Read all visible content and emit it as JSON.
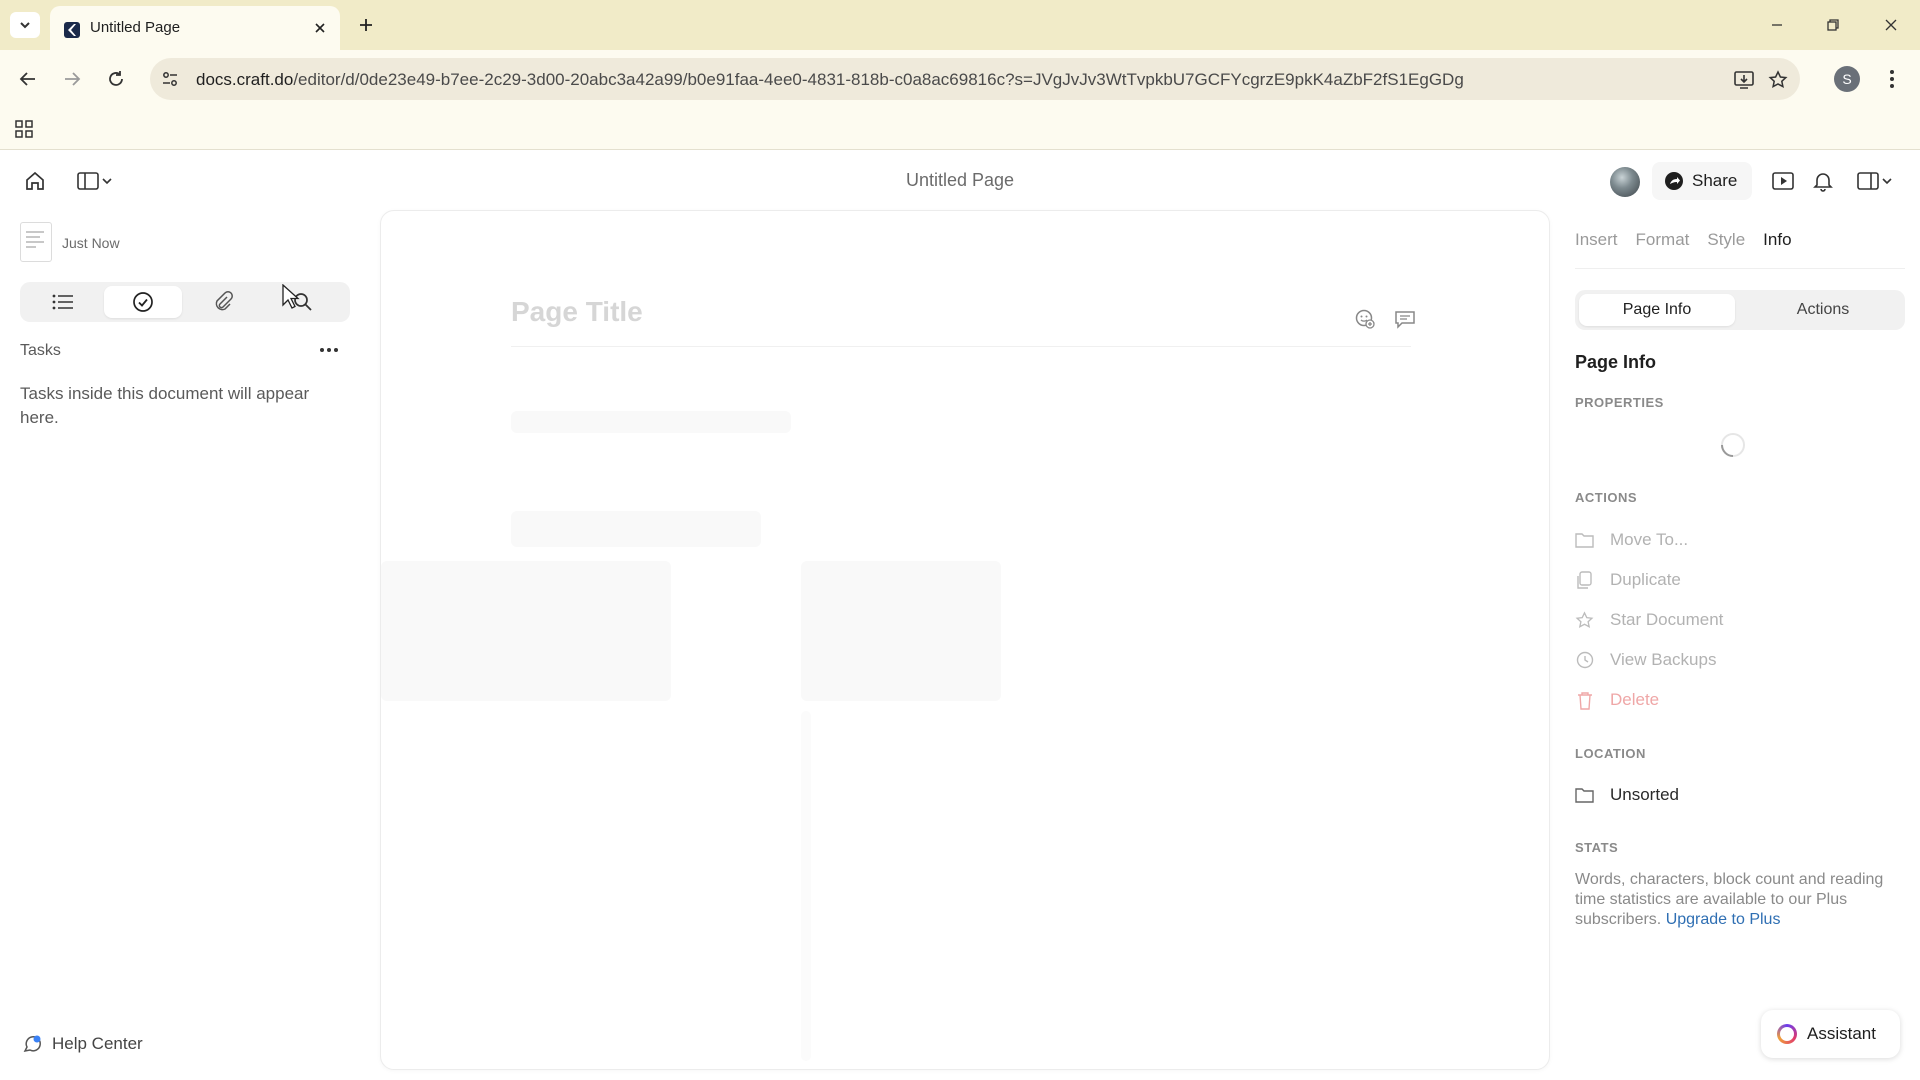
{
  "browser": {
    "tab_title": "Untitled Page",
    "url_host": "docs.craft.do",
    "url_path": "/editor/d/0de23e49-b7ee-2c29-3d00-20abc3a42a99/b0e91faa-4ee0-4831-818b-c0a8ac69816c?s=JVgJvJv3WtTvpkbU7GCFYcgrzE9pkK4aZbF2fS1EgGDg",
    "profile_initial": "S"
  },
  "header": {
    "doc_title": "Untitled Page",
    "share_label": "Share"
  },
  "sidebar": {
    "last_edited": "Just Now",
    "tasks_label": "Tasks",
    "tasks_empty": "Tasks inside this document will appear here.",
    "help_center": "Help Center"
  },
  "editor": {
    "title_placeholder": "Page Title"
  },
  "inspector": {
    "tabs": [
      "Insert",
      "Format",
      "Style",
      "Info"
    ],
    "active_tab": "Info",
    "segments": [
      "Page Info",
      "Actions"
    ],
    "heading": "Page Info",
    "properties_label": "PROPERTIES",
    "actions_label": "ACTIONS",
    "actions": [
      "Move To...",
      "Duplicate",
      "Star Document",
      "View Backups",
      "Delete"
    ],
    "location_label": "LOCATION",
    "location_value": "Unsorted",
    "stats_label": "STATS",
    "stats_text": "Words, characters, block count and reading time statistics are available to our Plus subscribers.",
    "upgrade_link": "Upgrade to Plus"
  },
  "assistant_label": "Assistant",
  "colors": {
    "tabbar_bg": "#f1ebc8",
    "accent_link": "#2f6fb3",
    "danger": "#efa7a7"
  }
}
